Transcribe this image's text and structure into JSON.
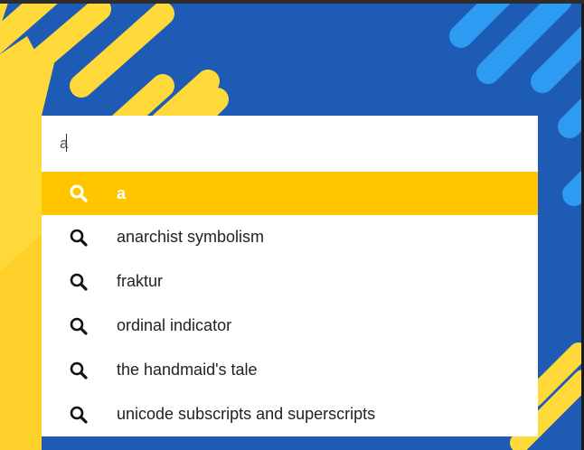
{
  "search": {
    "query": "a",
    "background_colors": {
      "blue": "#1e5bb5",
      "yellow": "#ffd83a",
      "light_blue": "#2e9bf2"
    }
  },
  "suggestions": [
    {
      "label": "a",
      "active": true,
      "icon": "search-icon"
    },
    {
      "label": "anarchist symbolism",
      "active": false,
      "icon": "search-icon"
    },
    {
      "label": "fraktur",
      "active": false,
      "icon": "search-icon"
    },
    {
      "label": "ordinal indicator",
      "active": false,
      "icon": "search-icon"
    },
    {
      "label": "the handmaid's tale",
      "active": false,
      "icon": "search-icon"
    },
    {
      "label": "unicode subscripts and superscripts",
      "active": false,
      "icon": "search-icon"
    }
  ],
  "colors": {
    "highlight": "#ffc600",
    "text": "#222222",
    "highlight_text": "#ffffff"
  }
}
